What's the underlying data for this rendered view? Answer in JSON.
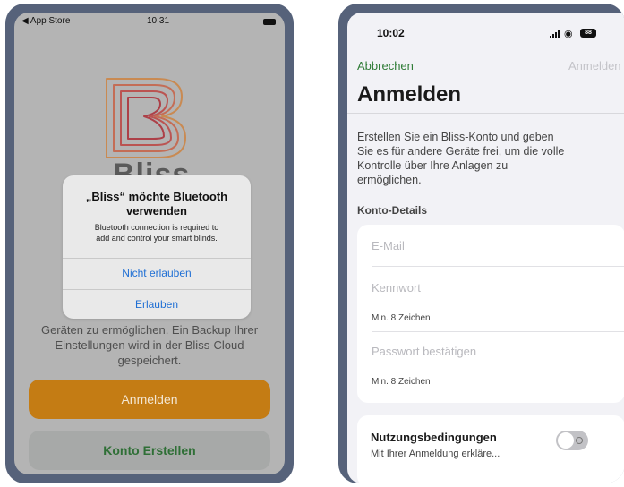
{
  "left": {
    "status": {
      "back": "◀ App Store",
      "time": "10:31"
    },
    "logo_text": "Bliss",
    "description_lines": [
      "Ers                                    olle",
      "Ko                                       en",
      "Geräten zu ermöglichen. Ein Backup Ihrer",
      "Einstellungen wird in der Bliss-Cloud",
      "gespeichert."
    ],
    "buttons": {
      "anmelden": "Anmelden",
      "konto": "Konto Erstellen"
    },
    "alert": {
      "title_line1": "„Bliss“ möchte Bluetooth",
      "title_line2": "verwenden",
      "message_line1": "Bluetooth connection is required to",
      "message_line2": "add and control your smart blinds.",
      "deny": "Nicht erlauben",
      "allow": "Erlauben"
    },
    "colors": {
      "accent": "#c47c14",
      "link": "#1f6fd4"
    }
  },
  "right": {
    "status": {
      "time": "10:02",
      "battery": "88"
    },
    "nav": {
      "cancel": "Abbrechen",
      "submit": "Anmelden"
    },
    "title": "Anmelden",
    "description_lines": [
      "Erstellen Sie ein Bliss-Konto und geben",
      "Sie es für andere Geräte frei, um die volle",
      "Kontrolle über Ihre Anlagen zu",
      "ermöglichen."
    ],
    "section": "Konto-Details",
    "fields": {
      "email_placeholder": "E-Mail",
      "password_placeholder": "Kennwort",
      "password_hint": "Min. 8 Zeichen",
      "confirm_placeholder": "Passwort bestätigen",
      "confirm_hint": "Min. 8 Zeichen"
    },
    "terms": {
      "title": "Nutzungsbedingungen",
      "subtitle": "Mit Ihrer Anmeldung erkläre..."
    },
    "colors": {
      "accent": "#2f7c36"
    }
  }
}
